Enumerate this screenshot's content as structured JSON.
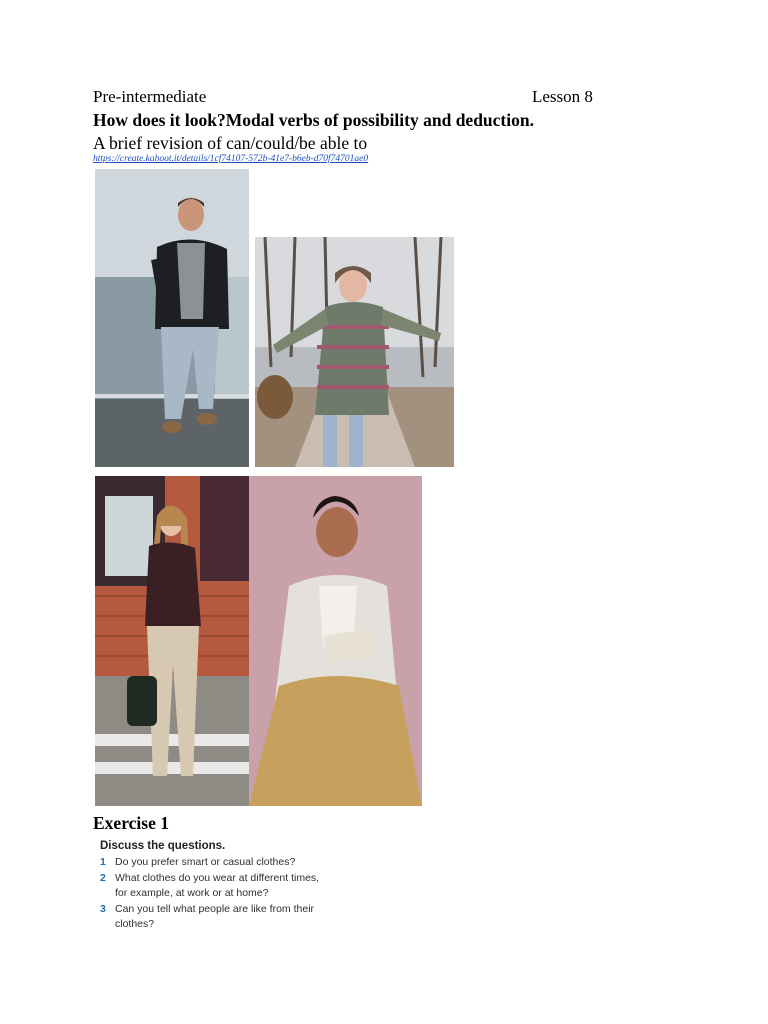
{
  "header": {
    "level": "Pre-intermediate",
    "lesson": "Lesson 8",
    "title": "How does it look?Modal verbs of possibility and deduction.",
    "revision": "A brief revision of can/could/be able to",
    "link": "https://create.kahoot.it/details/1cf74107-572b-41e7-b6eb-d70f74701ae0"
  },
  "photos": [
    {
      "name": "photo-man-leather-jacket"
    },
    {
      "name": "photo-woman-winter-sweater"
    },
    {
      "name": "photo-woman-street-handbag"
    },
    {
      "name": "photo-woman-yellow-skirt"
    }
  ],
  "exercise": {
    "title": "Exercise 1",
    "heading": "Discuss the questions.",
    "questions": [
      {
        "num": "1",
        "text": "Do you prefer smart or casual clothes?"
      },
      {
        "num": "2",
        "text": "What clothes do you wear at different times, for example, at work or at home?"
      },
      {
        "num": "3",
        "text": "Can you tell what people are like from their clothes?"
      }
    ]
  },
  "colors": {
    "link": "#1a4fbf",
    "question_number": "#1f6ea8"
  }
}
